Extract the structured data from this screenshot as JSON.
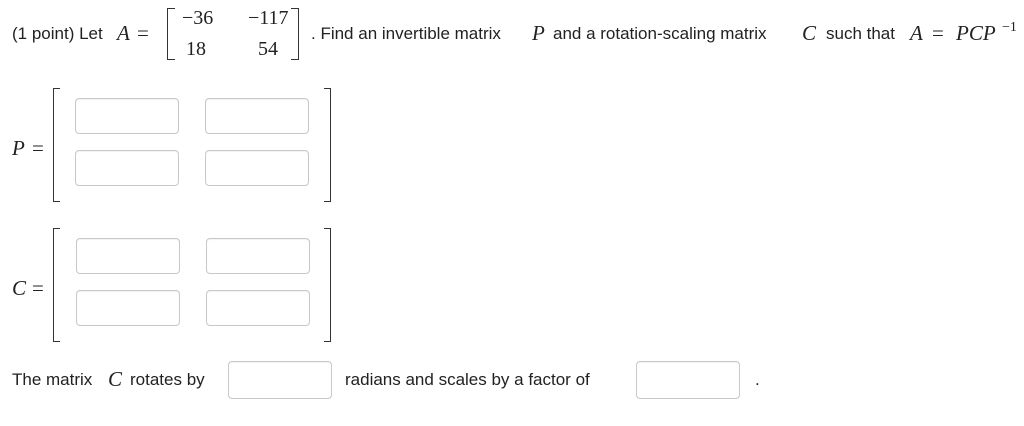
{
  "problem": {
    "points": "(1 point) Let",
    "var_a": "A",
    "equals": "=",
    "matrix_a": [
      [
        "−36",
        "−117"
      ],
      [
        "18",
        "54"
      ]
    ],
    "text1": ". Find an invertible matrix",
    "var_p": "P",
    "text2": "and a rotation-scaling matrix",
    "var_c": "C",
    "text3": "such that",
    "eq_lhs": "A",
    "eq_rhs": "PCP",
    "eq_sup": "−1"
  },
  "matrix_p": {
    "var": "P",
    "equals": "=",
    "cells": [
      [
        "",
        ""
      ],
      [
        "",
        ""
      ]
    ]
  },
  "matrix_c": {
    "var": "C",
    "equals": "=",
    "cells": [
      [
        "",
        ""
      ],
      [
        "",
        ""
      ]
    ]
  },
  "rotation": {
    "text1": "The matrix",
    "var": "C",
    "text2": "rotates by",
    "radians_value": "",
    "text3": "radians and scales by a factor of",
    "scale_value": "",
    "period": "."
  }
}
